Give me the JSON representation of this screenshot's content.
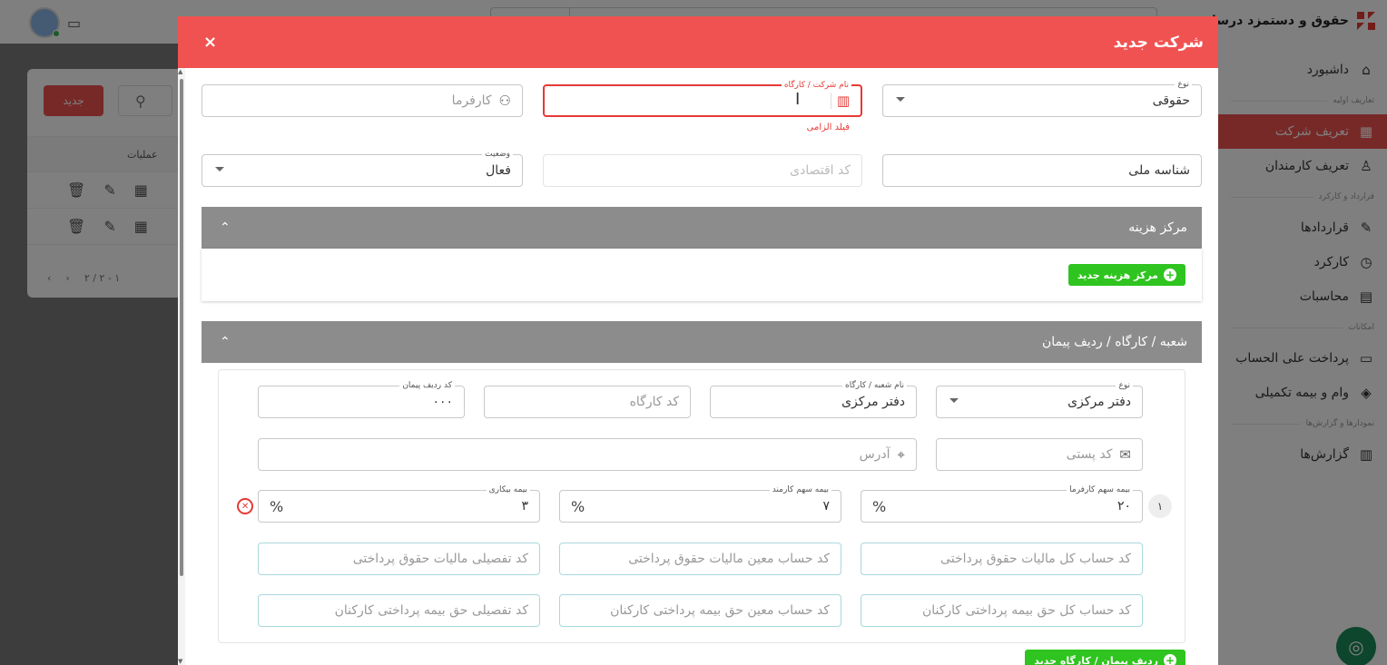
{
  "app": {
    "brand_name": "حقوق و دستمزد درسان"
  },
  "sidebar": {
    "items": [
      {
        "label": "داشبورد",
        "icon": "home-icon"
      },
      {
        "section": "تعاریف اولیه"
      },
      {
        "label": "تعریف شرکت",
        "icon": "building-icon",
        "active": true
      },
      {
        "label": "تعریف کارمندان",
        "icon": "person-icon"
      },
      {
        "section": "قرارداد و کارکرد"
      },
      {
        "label": "قراردادها",
        "icon": "contract-icon"
      },
      {
        "label": "کارکرد",
        "icon": "worktime-icon"
      },
      {
        "label": "محاسبات",
        "icon": "calculator-icon"
      },
      {
        "section": "امکانات"
      },
      {
        "label": "پرداخت علی الحساب",
        "icon": "card-icon"
      },
      {
        "label": "وام و بیمه تکمیلی",
        "icon": "loan-icon"
      },
      {
        "section": "نمودارها و گزارش‌ها"
      },
      {
        "label": "گزارش‌ها",
        "icon": "report-icon"
      }
    ]
  },
  "list": {
    "new_label": "جدید",
    "ops_header": "عملیات",
    "pagination": "۲ / ۲ - ۱"
  },
  "modal": {
    "title": "شرکت جدید",
    "close": "×",
    "type": {
      "label": "نوع",
      "value": "حقوقی"
    },
    "company_name": {
      "label": "نام شرکت / کارگاه",
      "value": "",
      "helper": "فیلد الزامی"
    },
    "employer": {
      "placeholder": "کارفرما"
    },
    "national_id": {
      "value": "شناسه ملی"
    },
    "economic_code": {
      "placeholder": "کد اقتصادی"
    },
    "status": {
      "label": "وضعیت",
      "value": "فعال"
    },
    "cost_center": {
      "title": "مرکز هزینه",
      "add_label": "مرکز هزینه جدید"
    },
    "branch": {
      "title": "شعبه / کارگاه / ردیف پیمان",
      "type": {
        "label": "نوع",
        "value": "دفتر مرکزی"
      },
      "name": {
        "label": "نام شعبه / کارگاه",
        "value": "دفتر مرکزی"
      },
      "workshop_code": {
        "placeholder": "کد کارگاه"
      },
      "contract_row": {
        "label": "کد ردیف پیمان",
        "value": "۰۰۰"
      },
      "postal": {
        "placeholder": "کد پستی"
      },
      "address": {
        "placeholder": "آدرس"
      },
      "row_number": "۱",
      "employer_ins": {
        "label": "بیمه سهم کارفرما",
        "value": "۲۰"
      },
      "employee_ins": {
        "label": "بیمه سهم کارمند",
        "value": "۷"
      },
      "unemp_ins": {
        "label": "بیمه بیکاری",
        "value": "۳"
      },
      "pct": "%",
      "acc1": "کد حساب کل مالیات حقوق پرداختی",
      "acc2": "کد حساب معین مالیات حقوق پرداختی",
      "acc3": "کد تفصیلی مالیات حقوق پرداختی",
      "acc4": "کد حساب کل حق بیمه پرداختی کارکنان",
      "acc5": "کد حساب معین حق بیمه پرداختی کارکنان",
      "acc6": "کد تفصیلی حق بیمه پرداختی کارکنان",
      "add_label": "ردیف پیمان / کارگاه جدید"
    }
  }
}
